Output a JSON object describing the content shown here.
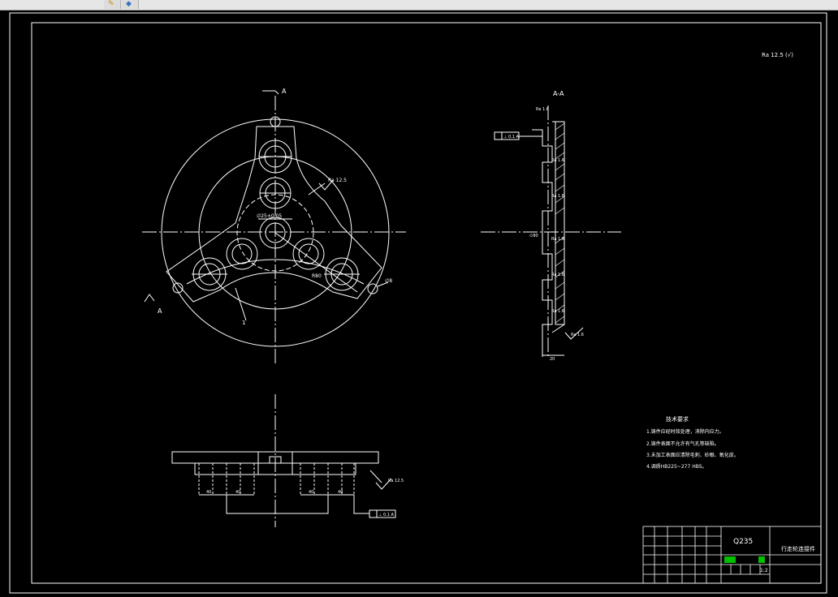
{
  "colors": {
    "background": "#000000",
    "lines": "#ffffff",
    "toolbar": "#e6e6e6",
    "title_block_green": "#00c000"
  },
  "toolbar": {
    "icons": [
      "pencil-icon",
      "layer-icon"
    ]
  },
  "drawing": {
    "section_marker": "A",
    "section_title": "A-A",
    "surface_finish_note": "Ra 12.5 (√)",
    "front_view": {
      "roughness_1": "Ra 12.5",
      "center_hole_callout": "∅25±0.05",
      "side_hole_callout": "∅8",
      "dimension_label": "R80",
      "leader_label": "1"
    },
    "section_view": {
      "datum_frame": "⊥ 0.1 A",
      "roughness_labels": [
        "Ra 1.6",
        "Ra 1.6",
        "Ra 1.6",
        "Ra 1.6",
        "Ra 1.6",
        "Ra 1.6",
        "Ra 1.6"
      ],
      "diameter_label": "∅80",
      "bottom_dim": "20"
    },
    "bottom_view": {
      "dims": [
        "40",
        "40",
        "40",
        "40"
      ],
      "roughness": "Ra 12.5",
      "datum_frame": "⊥ 0.1 A"
    },
    "tech_requirements": {
      "title": "技术要求",
      "items": [
        "1.铸件应经时效处理，消除内应力。",
        "2.铸件表面不允许有气孔等缺陷。",
        "3.未加工表面应清除毛刺、砂眼、氧化皮。",
        "4.调质HB225~277 HBS。"
      ]
    },
    "title_block": {
      "material": "Q235",
      "part_name": "行走轮连接件",
      "scale": "1:2"
    }
  }
}
